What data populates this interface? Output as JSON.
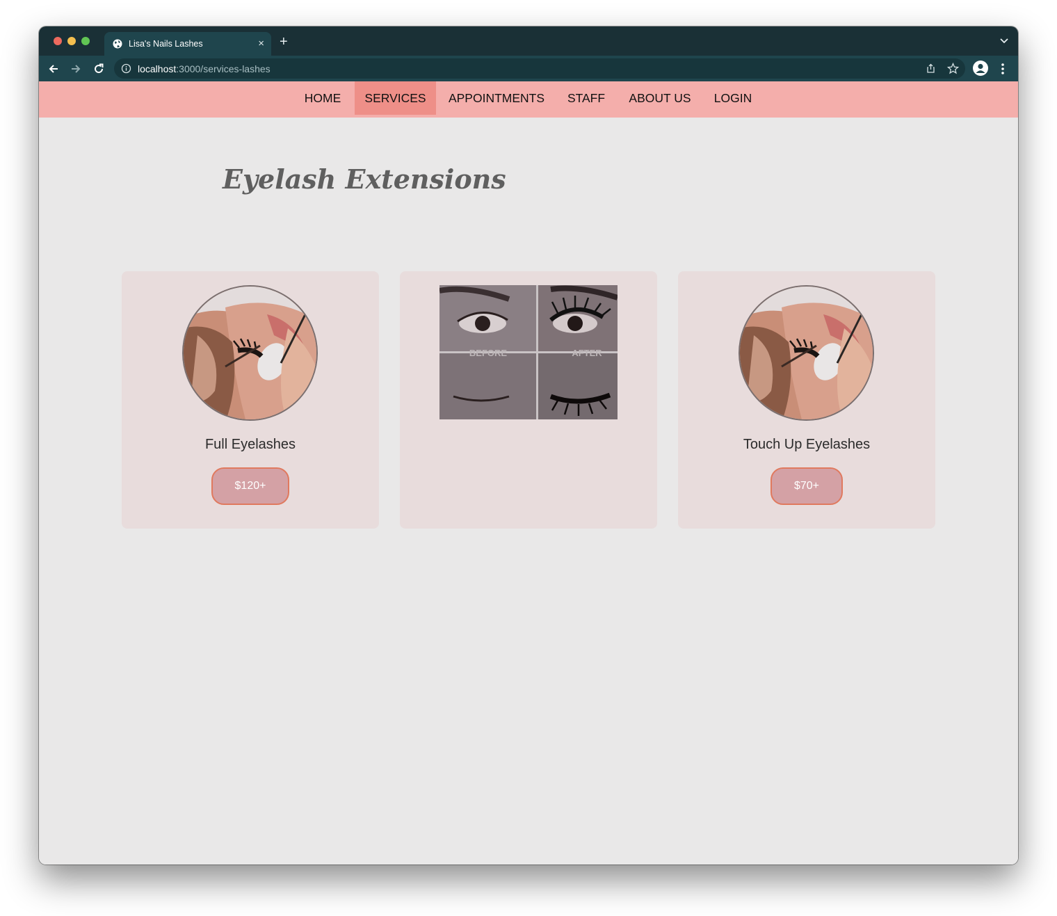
{
  "browser": {
    "tab_title": "Lisa's Nails Lashes",
    "tab_close": "×",
    "new_tab": "+",
    "url_host": "localhost",
    "url_path": ":3000/services-lashes"
  },
  "nav": {
    "items": [
      {
        "label": "HOME",
        "active": false
      },
      {
        "label": "SERVICES",
        "active": true
      },
      {
        "label": "APPOINTMENTS",
        "active": false
      },
      {
        "label": "STAFF",
        "active": false
      },
      {
        "label": "ABOUT US",
        "active": false
      },
      {
        "label": "LOGIN",
        "active": false
      }
    ]
  },
  "page": {
    "title": "Eyelash Extensions"
  },
  "cards": [
    {
      "name": "Full Eyelashes",
      "price": "$120+"
    },
    {
      "name": "",
      "price": "",
      "image_labels": [
        "BEFORE",
        "AFTER"
      ]
    },
    {
      "name": "Touch Up Eyelashes",
      "price": "$70+"
    }
  ],
  "colors": {
    "nav_bg": "#f4aeab",
    "nav_active": "#ee8f88",
    "card_bg": "#e8dcdc",
    "price_bg": "#d4a1a5",
    "price_border": "#e0795e",
    "page_bg": "#e9e8e8"
  },
  "icons": [
    "globe-icon",
    "back-arrow-icon",
    "forward-arrow-icon",
    "reload-icon",
    "info-icon",
    "share-icon",
    "star-icon",
    "profile-icon",
    "menu-dots-icon",
    "chevron-down-icon",
    "close-icon",
    "plus-icon"
  ]
}
